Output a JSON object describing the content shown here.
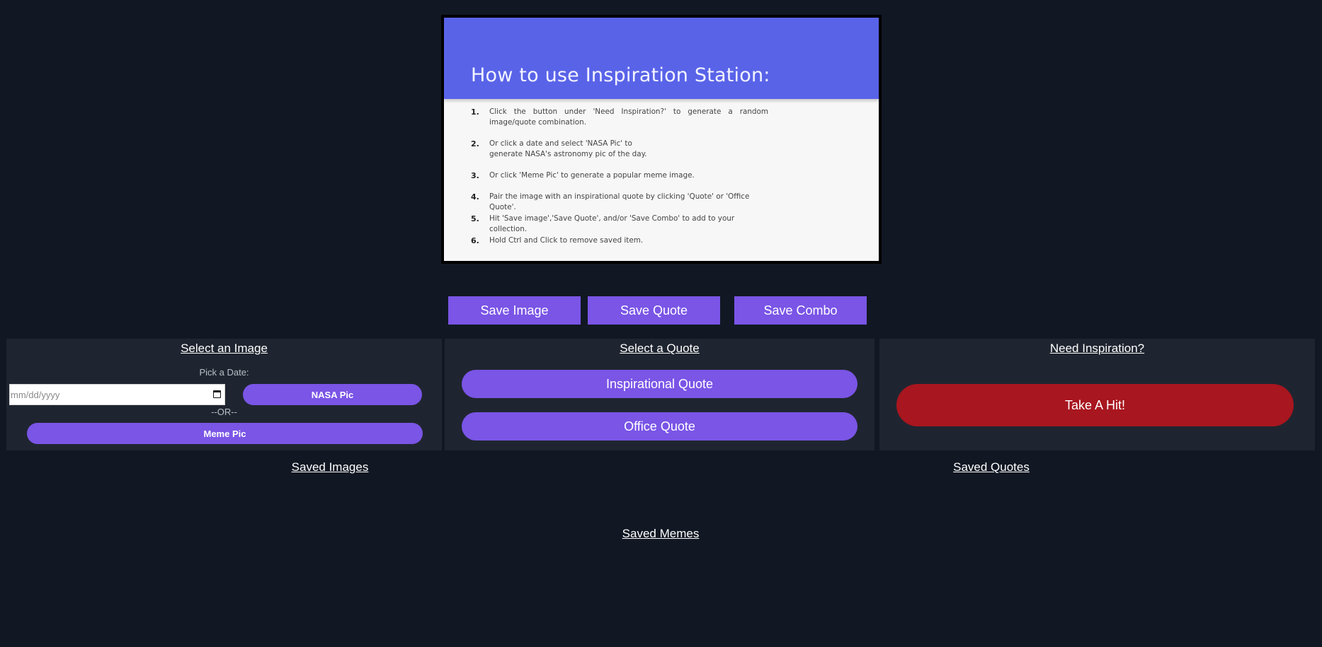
{
  "instructions": {
    "title": "How to use Inspiration Station:",
    "steps": [
      {
        "num": "1.",
        "text": "Click the button under 'Need Inspiration?' to generate a random image/quote combination."
      },
      {
        "num": "2.",
        "text": "Or click a date and select 'NASA Pic' to generate NASA's astronomy pic of the day."
      },
      {
        "num": "3.",
        "text": "Or click 'Meme Pic' to generate a popular meme image."
      },
      {
        "num": "4.",
        "text": "Pair the image with an inspirational quote by clicking 'Quote' or 'Office Quote'."
      },
      {
        "num": "5.",
        "text": "Hit 'Save image','Save Quote', and/or 'Save Combo' to add to your collection."
      },
      {
        "num": "6.",
        "text": "Hold Ctrl and Click to remove saved item."
      }
    ]
  },
  "save_buttons": {
    "image": "Save Image",
    "quote": "Save Quote",
    "combo": "Save Combo"
  },
  "image_panel": {
    "title": "Select an Image",
    "date_label": "Pick a Date:",
    "date_placeholder": "mm/dd/yyyy",
    "nasa_button": "NASA Pic",
    "or_text": "--OR--",
    "meme_button": "Meme Pic"
  },
  "quote_panel": {
    "title": "Select a Quote",
    "inspirational_button": "Inspirational Quote",
    "office_button": "Office Quote"
  },
  "inspire_panel": {
    "title": "Need Inspiration?",
    "hit_button": "Take A Hit!"
  },
  "saved": {
    "images": "Saved Images",
    "quotes": "Saved Quotes",
    "memes": "Saved Memes"
  },
  "colors": {
    "background": "#111823",
    "panel": "#1f2530",
    "accent": "#7a55e6",
    "danger": "#a8161f",
    "slide_header": "#5963e8"
  }
}
